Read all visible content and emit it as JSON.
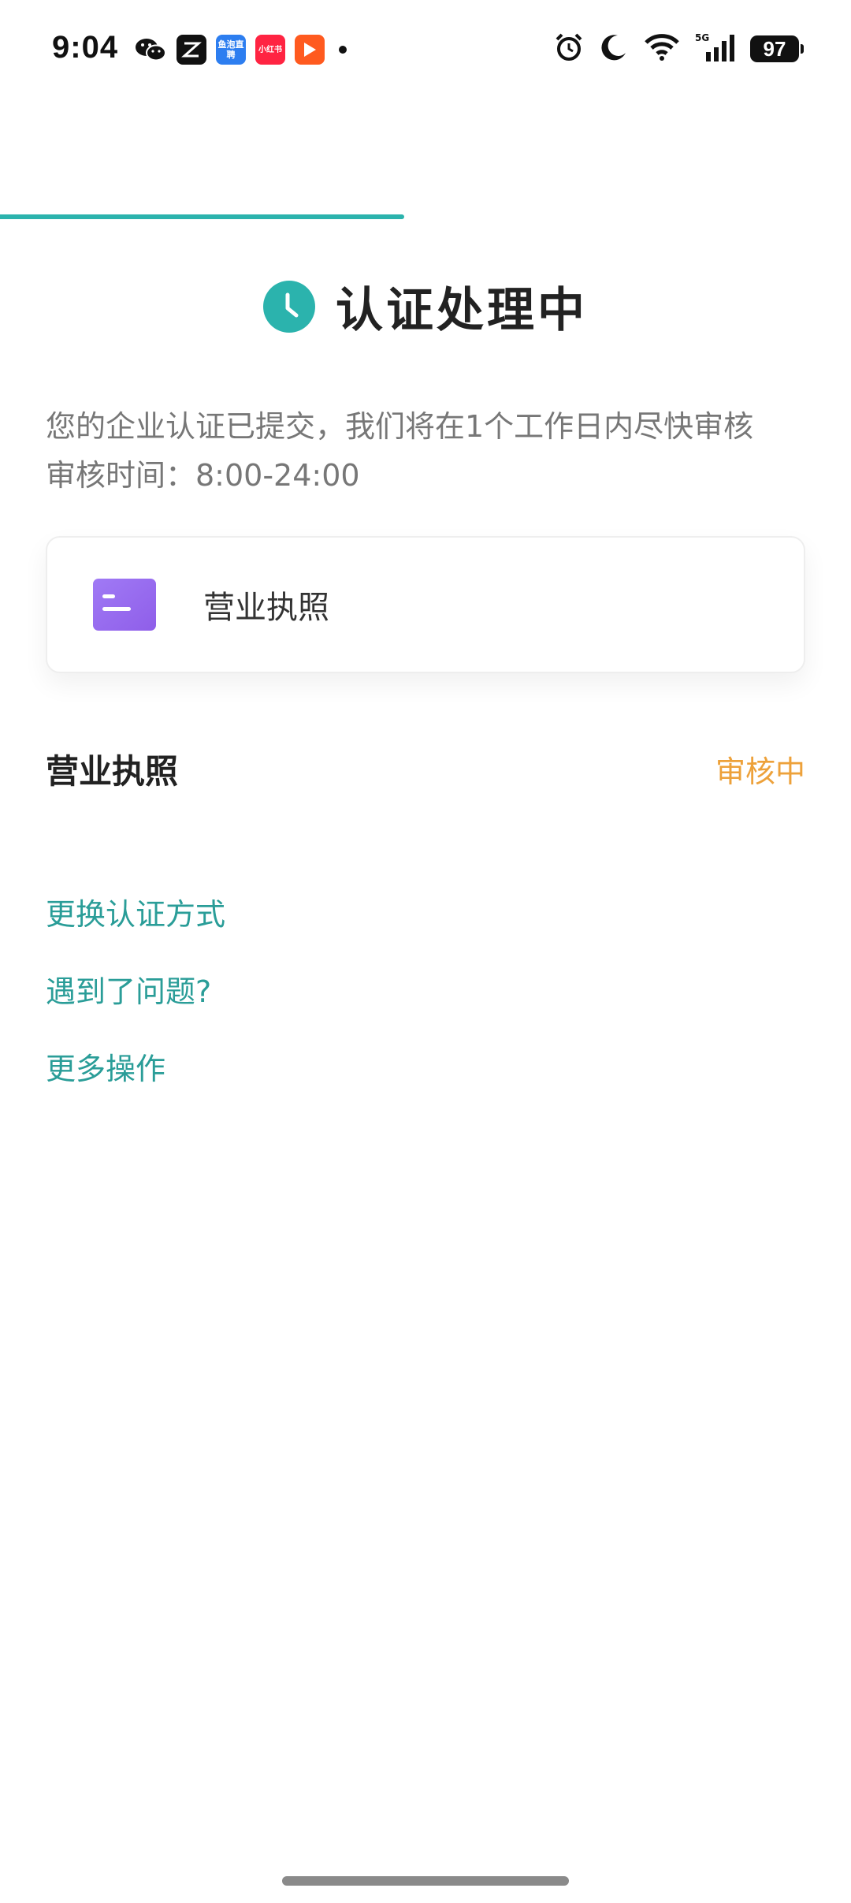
{
  "status_bar": {
    "time": "9:04",
    "battery": "97",
    "notifications": [
      {
        "name": "wechat-icon",
        "label": ""
      },
      {
        "name": "capcut-icon",
        "label": ""
      },
      {
        "name": "yupao-icon",
        "label": "鱼泡直聘"
      },
      {
        "name": "xiaohongshu-icon",
        "label": "小红书"
      },
      {
        "name": "video-play-icon",
        "label": ""
      }
    ]
  },
  "progress": {
    "fraction": 0.475,
    "color": "#2bb3ad"
  },
  "header": {
    "title": "认证处理中",
    "icon": "clock-icon",
    "icon_color": "#2bb3ad"
  },
  "description": {
    "line1": "您的企业认证已提交，我们将在1个工作日内尽快审核",
    "line2": "审核时间：8:00-24:00"
  },
  "document_card": {
    "label": "营业执照",
    "icon": "document-icon",
    "icon_color": "#9b6cf2"
  },
  "status_row": {
    "title": "营业执照",
    "status": "审核中",
    "status_color": "#eda13a"
  },
  "links": {
    "change_method": "更换认证方式",
    "problem": "遇到了问题?",
    "more": "更多操作",
    "color": "#2a9d98"
  }
}
